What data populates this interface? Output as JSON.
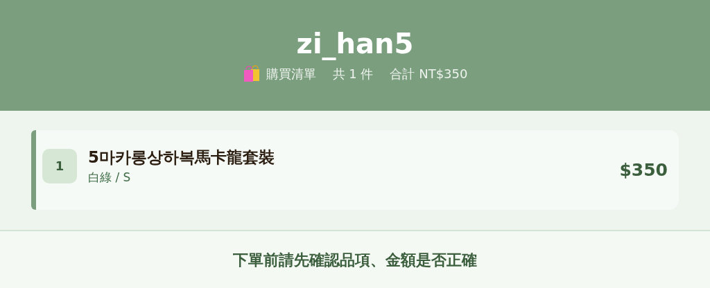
{
  "header": {
    "title": "zi_han5",
    "list_label": "購買清單",
    "count": "共 1 件",
    "total": "合計 NT$350"
  },
  "items": [
    {
      "index": "1",
      "name": "5마카롱상하복馬卡龍套裝",
      "variant": "白綠 / S",
      "price": "$350"
    }
  ],
  "footer": {
    "note": "下單前請先確認品項、金額是否正確"
  }
}
